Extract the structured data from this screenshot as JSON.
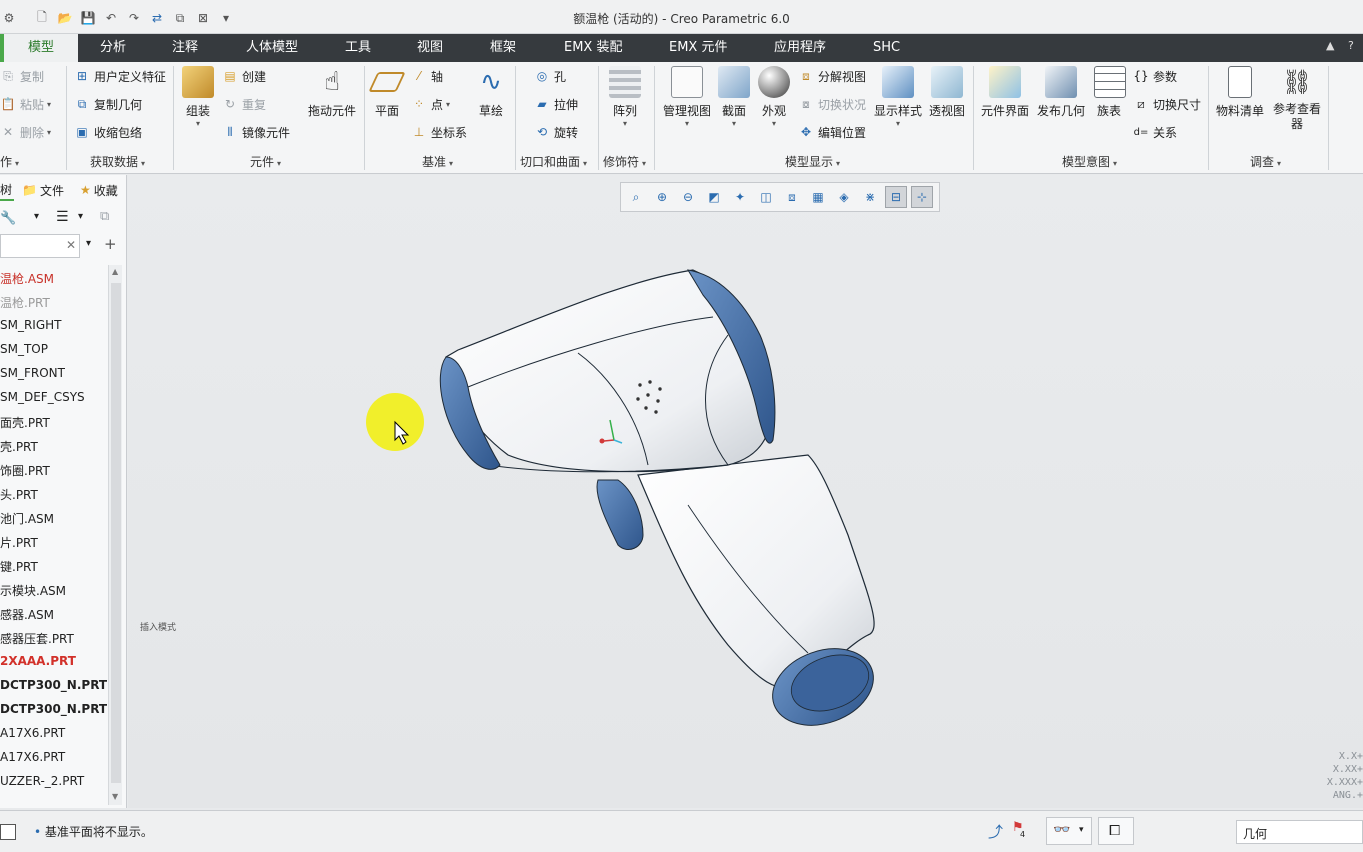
{
  "window": {
    "title": "额温枪 (活动的) - Creo Parametric 6.0"
  },
  "tabs": [
    "模型",
    "分析",
    "注释",
    "人体模型",
    "工具",
    "视图",
    "框架",
    "EMX 装配",
    "EMX 元件",
    "应用程序",
    "SHC"
  ],
  "ribbon": {
    "operations": {
      "copy": "复制",
      "paste": "粘贴",
      "delete": "删除",
      "label": "作"
    },
    "get_data": {
      "udf": "用户定义特征",
      "copy_geom": "复制几何",
      "shrinkwrap": "收缩包络",
      "label": "获取数据"
    },
    "component": {
      "assemble": "组装",
      "create": "创建",
      "repeat": "重复",
      "mirror": "镜像元件",
      "drag": "拖动元件",
      "label": "元件"
    },
    "datum": {
      "plane": "平面",
      "axis": "轴",
      "point": "点",
      "csys": "坐标系",
      "sketch": "草绘",
      "label": "基准"
    },
    "cut_surface": {
      "hole": "孔",
      "extrude": "拉伸",
      "revolve": "旋转",
      "label": "切口和曲面"
    },
    "modifiers": {
      "pattern": "阵列",
      "label": "修饰符"
    },
    "model_display": {
      "manage_views": "管理视图",
      "section": "截面",
      "appearance": "外观",
      "explode": "分解视图",
      "toggle_status": "切换状况",
      "edit_position": "编辑位置",
      "display_style": "显示样式",
      "perspective": "透视图",
      "label": "模型显示"
    },
    "model_intent": {
      "comp_interface": "元件界面",
      "publish_geom": "发布几何",
      "family_table": "族表",
      "params": "参数",
      "switch_dims": "切换尺寸",
      "relations": "关系",
      "label": "模型意图"
    },
    "investigate": {
      "bom": "物料清单",
      "ref_viewer": "参考查看器",
      "label": "调查"
    }
  },
  "left_panel": {
    "tabs": [
      "树",
      "文件",
      "收藏"
    ],
    "tree": [
      {
        "text": "温枪.ASM",
        "style": "red"
      },
      {
        "text": "温枪.PRT",
        "style": "grey"
      },
      {
        "text": "SM_RIGHT",
        "style": "normal"
      },
      {
        "text": "SM_TOP",
        "style": "normal"
      },
      {
        "text": "SM_FRONT",
        "style": "normal"
      },
      {
        "text": "SM_DEF_CSYS",
        "style": "normal"
      },
      {
        "text": "面壳.PRT",
        "style": "normal"
      },
      {
        "text": "壳.PRT",
        "style": "normal"
      },
      {
        "text": "饰圈.PRT",
        "style": "normal"
      },
      {
        "text": "头.PRT",
        "style": "normal"
      },
      {
        "text": "池门.ASM",
        "style": "normal"
      },
      {
        "text": "片.PRT",
        "style": "normal"
      },
      {
        "text": "键.PRT",
        "style": "normal"
      },
      {
        "text": "示模块.ASM",
        "style": "normal"
      },
      {
        "text": "感器.ASM",
        "style": "normal"
      },
      {
        "text": "感器压套.PRT",
        "style": "normal"
      },
      {
        "text": "2XAAA.PRT",
        "style": "redbold"
      },
      {
        "text": "DCTP300_N.PRT",
        "style": "bold"
      },
      {
        "text": "DCTP300_N.PRT",
        "style": "bold"
      },
      {
        "text": "A17X6.PRT",
        "style": "normal"
      },
      {
        "text": "A17X6.PRT",
        "style": "normal"
      },
      {
        "text": "UZZER-_2.PRT",
        "style": "normal"
      }
    ]
  },
  "viewport": {
    "insert_mode": "插入模式",
    "coords": [
      "X.X+",
      "X.XX+",
      "X.XXX+",
      "ANG.+"
    ]
  },
  "status": {
    "message": "基准平面将不显示。",
    "filter": "几何",
    "flag_count": "4"
  },
  "colors": {
    "accent": "#4aa84a",
    "tab_bar": "#363a3e",
    "model_blue": "#3d6aa8"
  }
}
